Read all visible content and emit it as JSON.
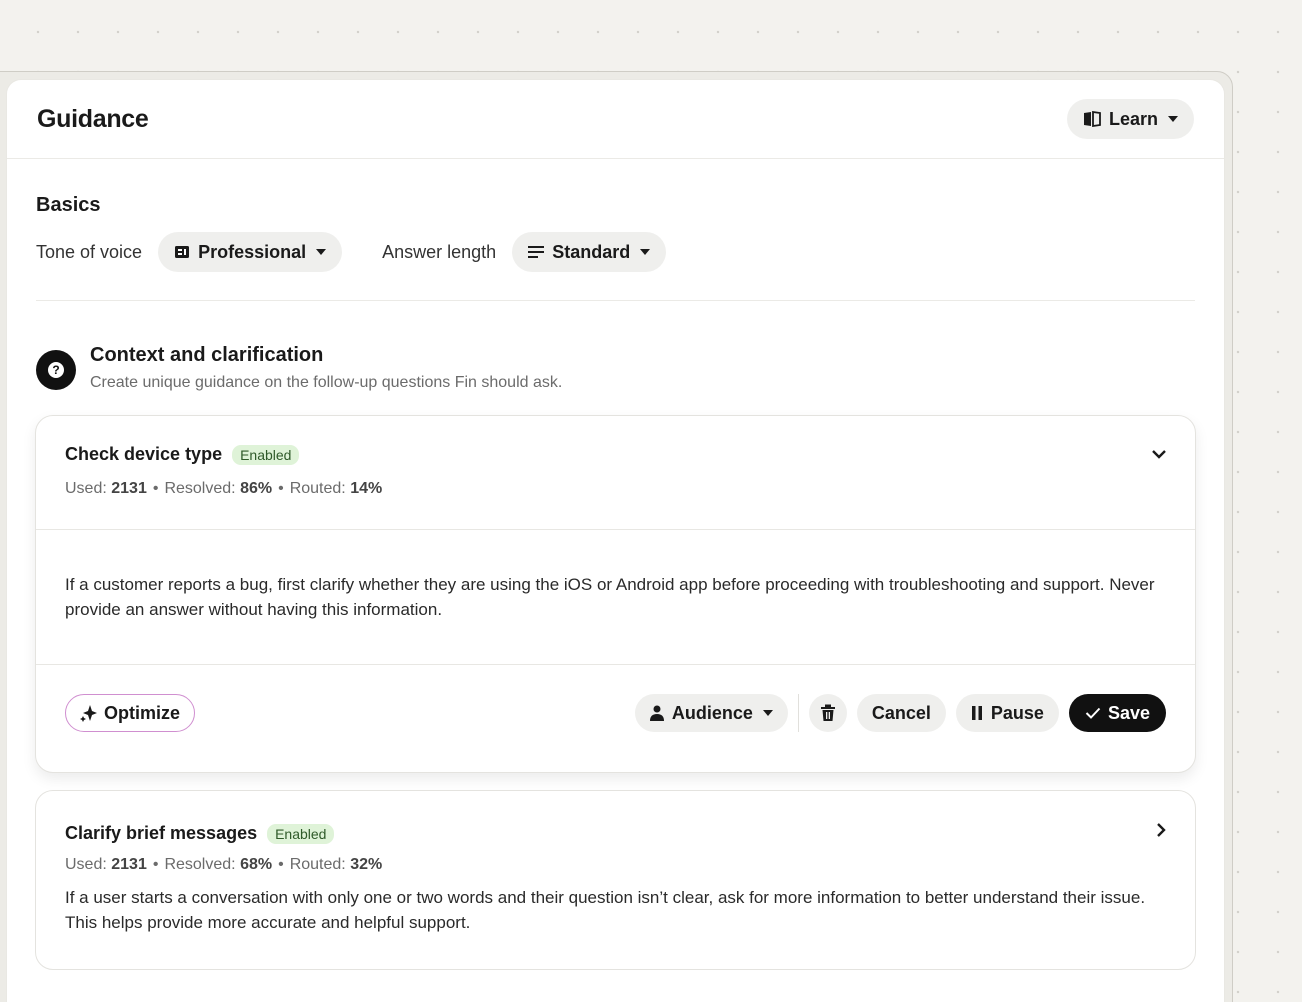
{
  "header": {
    "title": "Guidance",
    "learn_label": "Learn"
  },
  "basics": {
    "title": "Basics",
    "tone_label": "Tone of voice",
    "tone_value": "Professional",
    "length_label": "Answer length",
    "length_value": "Standard"
  },
  "context": {
    "title": "Context and clarification",
    "subtitle": "Create unique guidance on the follow-up questions Fin should ask."
  },
  "cards": [
    {
      "title": "Check device type",
      "status": "Enabled",
      "used_label": "Used:",
      "used": "2131",
      "resolved_label": "Resolved:",
      "resolved": "86%",
      "routed_label": "Routed:",
      "routed": "14%",
      "body": "If a customer reports a bug, first clarify whether they are using the iOS or Android app before proceeding with troubleshooting and support. Never provide an answer without having this information.",
      "actions": {
        "optimize": "Optimize",
        "audience": "Audience",
        "cancel": "Cancel",
        "pause": "Pause",
        "save": "Save"
      }
    },
    {
      "title": "Clarify brief messages",
      "status": "Enabled",
      "used_label": "Used:",
      "used": "2131",
      "resolved_label": "Resolved:",
      "resolved": "68%",
      "routed_label": "Routed:",
      "routed": "32%",
      "body": "If a user starts a conversation with only one or two words and their question isn’t clear, ask for more information to better understand their issue. This helps provide more accurate and helpful support."
    }
  ],
  "colors": {
    "accent_dark": "#111111",
    "badge_bg": "#dff3d8",
    "badge_text": "#2f5a29",
    "background": "#f3f2ee"
  }
}
